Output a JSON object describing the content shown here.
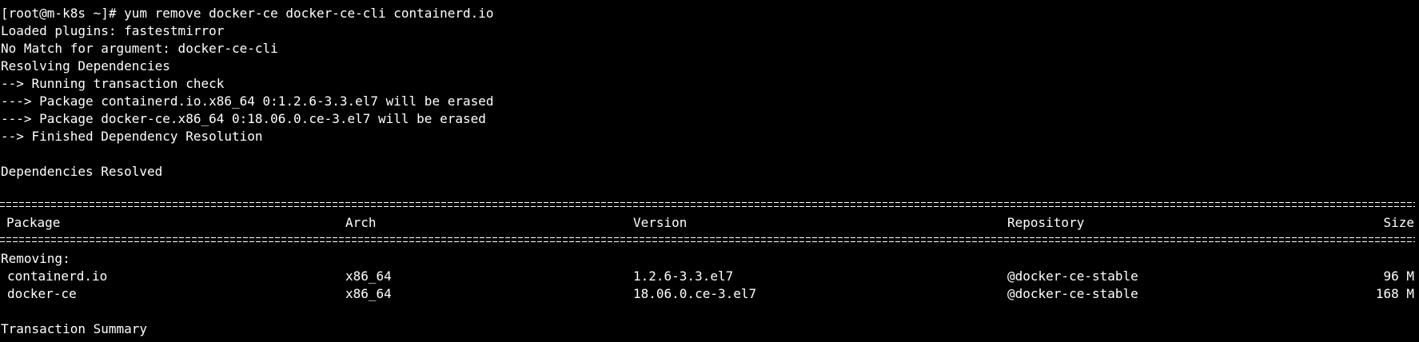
{
  "terminal": {
    "lines": [
      "[root@m-k8s ~]# yum remove docker-ce docker-ce-cli containerd.io",
      "Loaded plugins: fastestmirror",
      "No Match for argument: docker-ce-cli",
      "Resolving Dependencies",
      "--> Running transaction check",
      "---> Package containerd.io.x86_64 0:1.2.6-3.3.el7 will be erased",
      "---> Package docker-ce.x86_64 0:18.06.0.ce-3.el7 will be erased",
      "--> Finished Dependency Resolution",
      "Dependencies Resolved"
    ],
    "table": {
      "headers": {
        "package": "Package",
        "arch": "Arch",
        "version": "Version",
        "repository": "Repository",
        "size": "Size"
      },
      "section_label": "Removing:",
      "rows": [
        {
          "package": "containerd.io",
          "arch": "x86_64",
          "version": "1.2.6-3.3.el7",
          "repository": "@docker-ce-stable",
          "size": "96 M"
        },
        {
          "package": "docker-ce",
          "arch": "x86_64",
          "version": "18.06.0.ce-3.el7",
          "repository": "@docker-ce-stable",
          "size": "168 M"
        }
      ]
    },
    "summary_label": "Transaction Summary"
  }
}
